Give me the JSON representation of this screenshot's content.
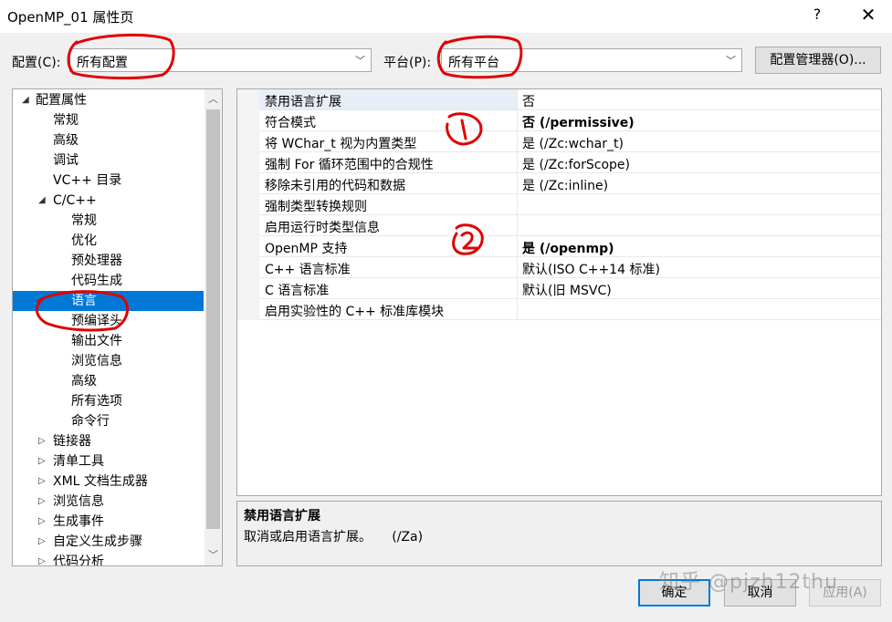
{
  "window": {
    "title": "OpenMP_01 属性页",
    "help": "?",
    "close": "✕"
  },
  "toolbar": {
    "config_label": "配置(C):",
    "config_value": "所有配置",
    "platform_label": "平台(P):",
    "platform_value": "所有平台",
    "config_manager": "配置管理器(O)..."
  },
  "tree": {
    "items": [
      {
        "label": "配置属性",
        "level": 0,
        "expander": "◢"
      },
      {
        "label": "常规",
        "level": 1
      },
      {
        "label": "高级",
        "level": 1
      },
      {
        "label": "调试",
        "level": 1
      },
      {
        "label": "VC++ 目录",
        "level": 1
      },
      {
        "label": "C/C++",
        "level": 1,
        "expander": "◢"
      },
      {
        "label": "常规",
        "level": 2
      },
      {
        "label": "优化",
        "level": 2
      },
      {
        "label": "预处理器",
        "level": 2
      },
      {
        "label": "代码生成",
        "level": 2
      },
      {
        "label": "语言",
        "level": 2,
        "selected": true
      },
      {
        "label": "预编译头",
        "level": 2
      },
      {
        "label": "输出文件",
        "level": 2
      },
      {
        "label": "浏览信息",
        "level": 2
      },
      {
        "label": "高级",
        "level": 2
      },
      {
        "label": "所有选项",
        "level": 2
      },
      {
        "label": "命令行",
        "level": 2
      },
      {
        "label": "链接器",
        "level": 1,
        "expander": "▷"
      },
      {
        "label": "清单工具",
        "level": 1,
        "expander": "▷"
      },
      {
        "label": "XML 文档生成器",
        "level": 1,
        "expander": "▷"
      },
      {
        "label": "浏览信息",
        "level": 1,
        "expander": "▷"
      },
      {
        "label": "生成事件",
        "level": 1,
        "expander": "▷"
      },
      {
        "label": "自定义生成步骤",
        "level": 1,
        "expander": "▷"
      },
      {
        "label": "代码分析",
        "level": 1,
        "expander": "▷"
      }
    ]
  },
  "properties": [
    {
      "name": "禁用语言扩展",
      "value": "否",
      "bold": false
    },
    {
      "name": "符合模式",
      "value": "否 (/permissive)",
      "bold": true
    },
    {
      "name": "将 WChar_t 视为内置类型",
      "value": "是 (/Zc:wchar_t)",
      "bold": false
    },
    {
      "name": "强制 For 循环范围中的合规性",
      "value": "是 (/Zc:forScope)",
      "bold": false
    },
    {
      "name": "移除未引用的代码和数据",
      "value": "是 (/Zc:inline)",
      "bold": false
    },
    {
      "name": "强制类型转换规则",
      "value": "",
      "bold": false
    },
    {
      "name": "启用运行时类型信息",
      "value": "",
      "bold": false
    },
    {
      "name": "OpenMP 支持",
      "value": "是 (/openmp)",
      "bold": true
    },
    {
      "name": "C++ 语言标准",
      "value": "默认(ISO C++14 标准)",
      "bold": false
    },
    {
      "name": "C 语言标准",
      "value": "默认(旧 MSVC)",
      "bold": false
    },
    {
      "name": "启用实验性的 C++ 标准库模块",
      "value": "",
      "bold": false
    }
  ],
  "description": {
    "title": "禁用语言扩展",
    "text": "取消或启用语言扩展。     (/Za)"
  },
  "buttons": {
    "ok": "确定",
    "cancel": "取消",
    "apply": "应用(A)"
  },
  "watermark": "知乎 @pjzh12thu",
  "colors": {
    "selection": "#0078d7",
    "annotation": "#e00000"
  }
}
